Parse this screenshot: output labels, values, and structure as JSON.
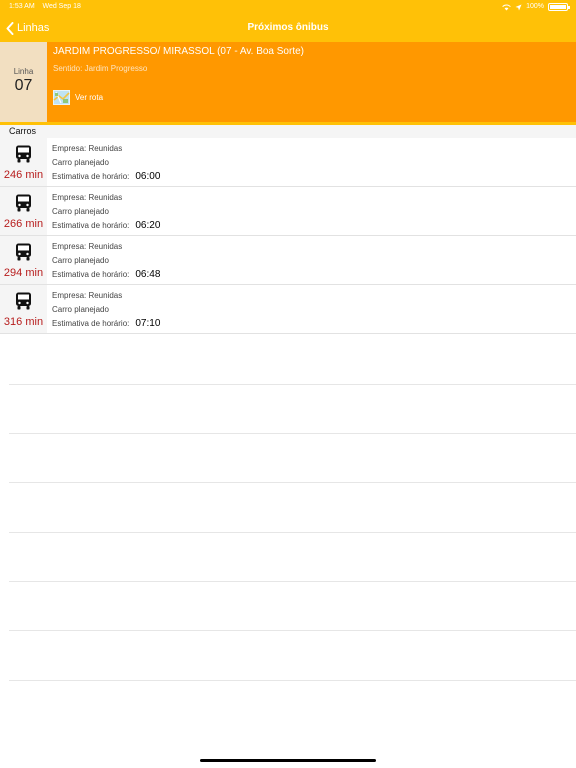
{
  "status_bar": {
    "time": "1:53 AM",
    "date": "Wed Sep 18",
    "battery": "100%"
  },
  "nav": {
    "back_label": "Linhas",
    "title": "Próximos ônibus"
  },
  "route": {
    "line_label": "Linha",
    "line_number": "07",
    "name": "JARDIM PROGRESSO/ MIRASSOL (07 - Av. Boa Sorte)",
    "direction": "Sentido: Jardim Progresso",
    "map_link": "Ver rota"
  },
  "section": {
    "title": "Carros"
  },
  "trips": [
    {
      "eta": "246 min",
      "company": "Empresa: Reunidas",
      "status": "Carro planejado",
      "time_label": "Estimativa de horário:",
      "time": "06:00"
    },
    {
      "eta": "266 min",
      "company": "Empresa: Reunidas",
      "status": "Carro planejado",
      "time_label": "Estimativa de horário:",
      "time": "06:20"
    },
    {
      "eta": "294 min",
      "company": "Empresa: Reunidas",
      "status": "Carro planejado",
      "time_label": "Estimativa de horário:",
      "time": "06:48"
    },
    {
      "eta": "316 min",
      "company": "Empresa: Reunidas",
      "status": "Carro planejado",
      "time_label": "Estimativa de horário:",
      "time": "07:10"
    }
  ],
  "colors": {
    "nav_bar": "#ffc107",
    "route_header": "#ff9800",
    "eta_text": "#b71c1c"
  },
  "icons": {
    "back": "chevron-left-icon",
    "map": "map-icon",
    "bus": "bus-icon"
  }
}
